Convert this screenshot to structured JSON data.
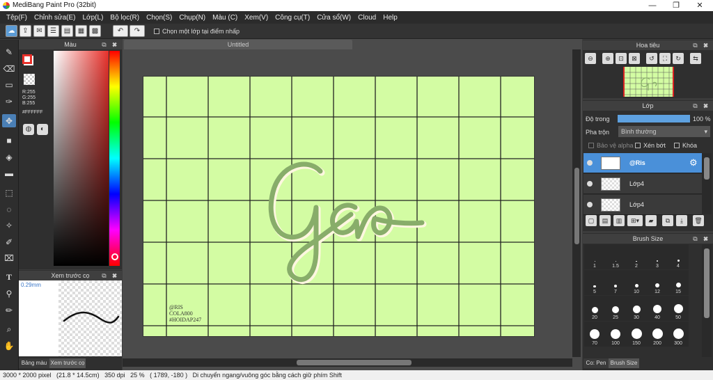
{
  "window": {
    "title": "MediBang Paint Pro (32bit)",
    "min": "—",
    "max": "❐",
    "close": "✕"
  },
  "menu": [
    "Tệp(F)",
    "Chỉnh sửa(E)",
    "Lớp(L)",
    "Bộ lọc(R)",
    "Chọn(S)",
    "Chụp(N)",
    "Màu (C)",
    "Xem(V)",
    "Công cụ(T)",
    "Cửa sổ(W)",
    "Cloud",
    "Help"
  ],
  "toolbar": {
    "checkbox_label": "Chọn một lớp tại điểm nhấp"
  },
  "color_panel": {
    "title": "Màu",
    "r": "R:255",
    "g": "G:255",
    "b": "B:255",
    "hex": "#FFFFFF"
  },
  "brush_preview": {
    "title": "Xem trước cọ",
    "size": "0.29mm",
    "tab1": "Bảng màu",
    "tab2": "Xem trước cọ"
  },
  "canvas": {
    "tab": "Untitled",
    "lettering": "Gao",
    "watermark": [
      "@RIS",
      "COLA800",
      "#HOIDAP247"
    ]
  },
  "navigator": {
    "title": "Hoa tiêu"
  },
  "layers": {
    "title": "Lớp",
    "opacity_label": "Độ trong",
    "opacity_value": "100 %",
    "opacity": 1.0,
    "blend_label": "Pha trộn",
    "blend_value": "Bình thường",
    "protect_alpha": "Bảo vệ alpha",
    "clipping": "Xén bớt",
    "lock": "Khóa",
    "items": [
      {
        "name": "@Ris",
        "selected": true
      },
      {
        "name": "Lớp4",
        "selected": false
      },
      {
        "name": "Lớp4",
        "selected": false
      }
    ]
  },
  "brush_size": {
    "title": "Brush Size",
    "sizes": [
      "1",
      "1.5",
      "2",
      "3",
      "4",
      "5",
      "7",
      "10",
      "12",
      "15",
      "20",
      "25",
      "30",
      "40",
      "50",
      "70",
      "100",
      "150",
      "200",
      "300"
    ],
    "tab1": "Co: Pen",
    "tab2": "Brush Size"
  },
  "status": {
    "text": "3000 * 2000 pixel   (21.8 * 14.5cm)   350 dpi   25 %   ( 1789, -180 )   Di chuyển ngang/vuông góc bằng cách giữ phím Shift"
  },
  "colors": {
    "accent": "#4a90d9",
    "canvas": "#d3fca3",
    "lettering": "#88ad6a",
    "foreground": "#e8312b"
  }
}
